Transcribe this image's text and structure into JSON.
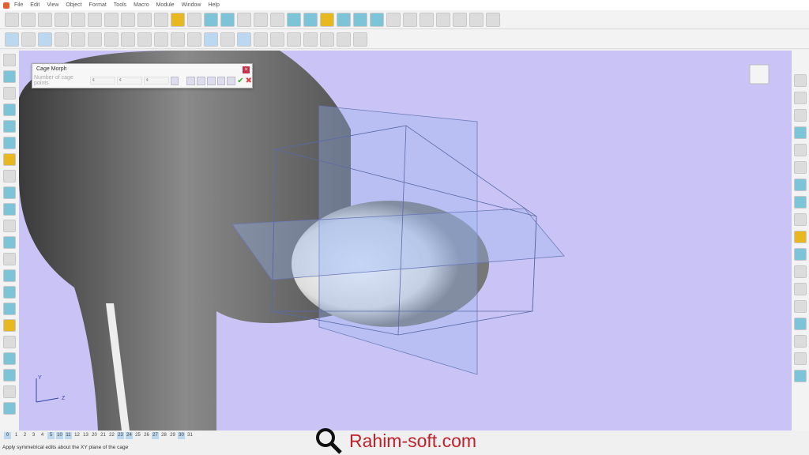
{
  "menu": [
    "File",
    "Edit",
    "View",
    "Object",
    "Format",
    "Tools",
    "Macro",
    "Module",
    "Window",
    "Help"
  ],
  "dialog": {
    "title": "Cage Morph",
    "label": "Number of cage points",
    "values": [
      "4",
      "4",
      "4"
    ],
    "close": "×",
    "ok": "✔",
    "cancel": "✖"
  },
  "layers": [
    {
      "n": "0",
      "on": true
    },
    {
      "n": "1"
    },
    {
      "n": "2"
    },
    {
      "n": "3"
    },
    {
      "n": "4"
    },
    {
      "n": "5",
      "on": true
    },
    {
      "n": "10",
      "on": true
    },
    {
      "n": "11",
      "on": true
    },
    {
      "n": "12"
    },
    {
      "n": "13"
    },
    {
      "n": "20"
    },
    {
      "n": "21"
    },
    {
      "n": "22"
    },
    {
      "n": "23",
      "on": true
    },
    {
      "n": "24",
      "on": true
    },
    {
      "n": "25"
    },
    {
      "n": "26"
    },
    {
      "n": "27",
      "on": true
    },
    {
      "n": "28"
    },
    {
      "n": "29"
    },
    {
      "n": "30",
      "on": true
    },
    {
      "n": "31"
    }
  ],
  "status": "Apply symmetrical edits about the XY plane of the cage",
  "watermark": "Rahim-soft.com",
  "axes": {
    "y": "Y",
    "z": "Z"
  },
  "colors": {
    "viewport": "#c9c4f5",
    "accent": "#c0202a"
  }
}
